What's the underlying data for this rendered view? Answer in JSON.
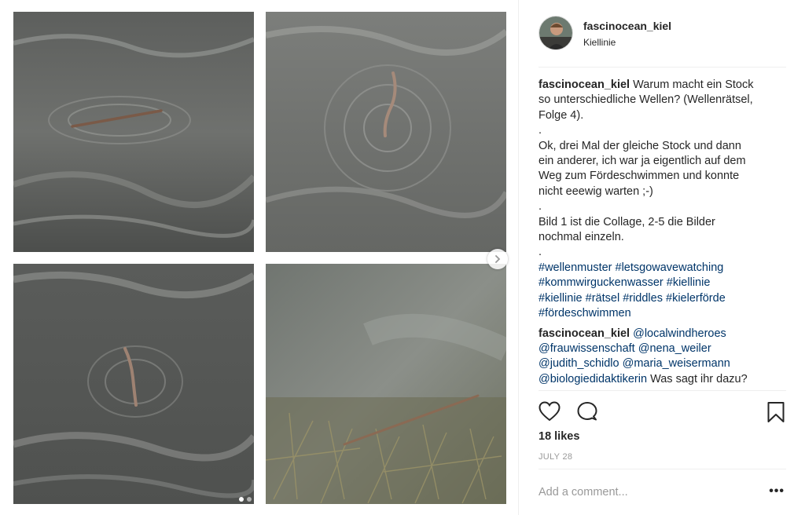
{
  "post": {
    "username": "fascinocean_kiel",
    "location": "Kiellinie",
    "caption": {
      "author": "fascinocean_kiel",
      "lines": [
        "Warum macht ein Stock",
        "so unterschiedliche Wellen? (Wellenrätsel,",
        "Folge 4).",
        ".",
        "Ok, drei Mal der gleiche Stock und dann",
        "ein anderer, ich war ja eigentlich auf dem",
        "Weg zum Fördeschwimmen und konnte",
        "nicht eeewig warten ;-)",
        ".",
        "Bild 1 ist die Collage, 2-5 die Bilder",
        "nochmal einzeln.",
        "."
      ],
      "hashtag_lines": [
        "#wellenmuster #letsgowavewatching",
        "#kommwirguckenwasser #kiellinie",
        "#kiellinie #rätsel #riddles #kielerförde",
        "#fördeschwimmen"
      ]
    },
    "comment": {
      "author": "fascinocean_kiel",
      "lines": [
        {
          "mention": "@localwindheroes",
          "text": ""
        },
        {
          "mention": "@frauwissenschaft @nena_weiler",
          "text": ""
        },
        {
          "mention": "@judith_schidlo @maria_weisermann",
          "text": ""
        },
        {
          "mention": "@biologiedidaktikerin",
          "text": " Was sagt ihr dazu?"
        }
      ]
    },
    "likes": "18 likes",
    "date": "JULY 28",
    "add_comment_placeholder": "Add a comment...",
    "more_label": "•••",
    "carousel": {
      "slides": 2,
      "active": 0
    }
  },
  "icons": {
    "like": "heart-icon",
    "comment": "comment-bubble-icon",
    "save": "bookmark-icon",
    "next": "chevron-right-icon"
  }
}
